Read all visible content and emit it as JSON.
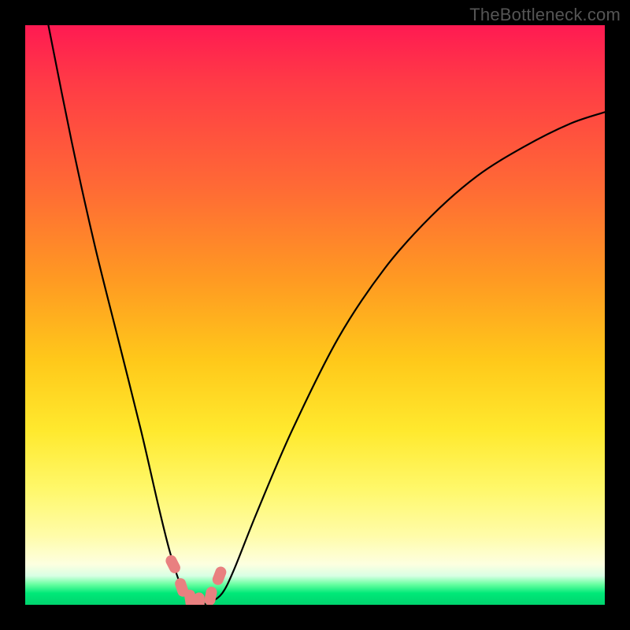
{
  "watermark": "TheBottleneck.com",
  "chart_data": {
    "type": "line",
    "title": "",
    "xlabel": "",
    "ylabel": "",
    "xlim": [
      0,
      100
    ],
    "ylim": [
      0,
      100
    ],
    "series": [
      {
        "name": "curve",
        "x": [
          4,
          8,
          12,
          16,
          20,
          23,
          25,
          27,
          29,
          30,
          32,
          34,
          36,
          40,
          46,
          54,
          62,
          70,
          78,
          86,
          94,
          100
        ],
        "values": [
          100,
          80,
          62,
          46,
          30,
          17,
          9,
          3,
          0.5,
          0,
          0.5,
          2,
          6,
          16,
          30,
          46,
          58,
          67,
          74,
          79,
          83,
          85
        ]
      }
    ],
    "markers": [
      {
        "x": 25.5,
        "y": 7
      },
      {
        "x": 27,
        "y": 3
      },
      {
        "x": 28.5,
        "y": 1
      },
      {
        "x": 30,
        "y": 0.5
      },
      {
        "x": 32,
        "y": 1.5
      },
      {
        "x": 33.5,
        "y": 5
      }
    ],
    "background_gradient": {
      "top_color": "#ff1a52",
      "bottom_color": "#00d46e"
    }
  }
}
